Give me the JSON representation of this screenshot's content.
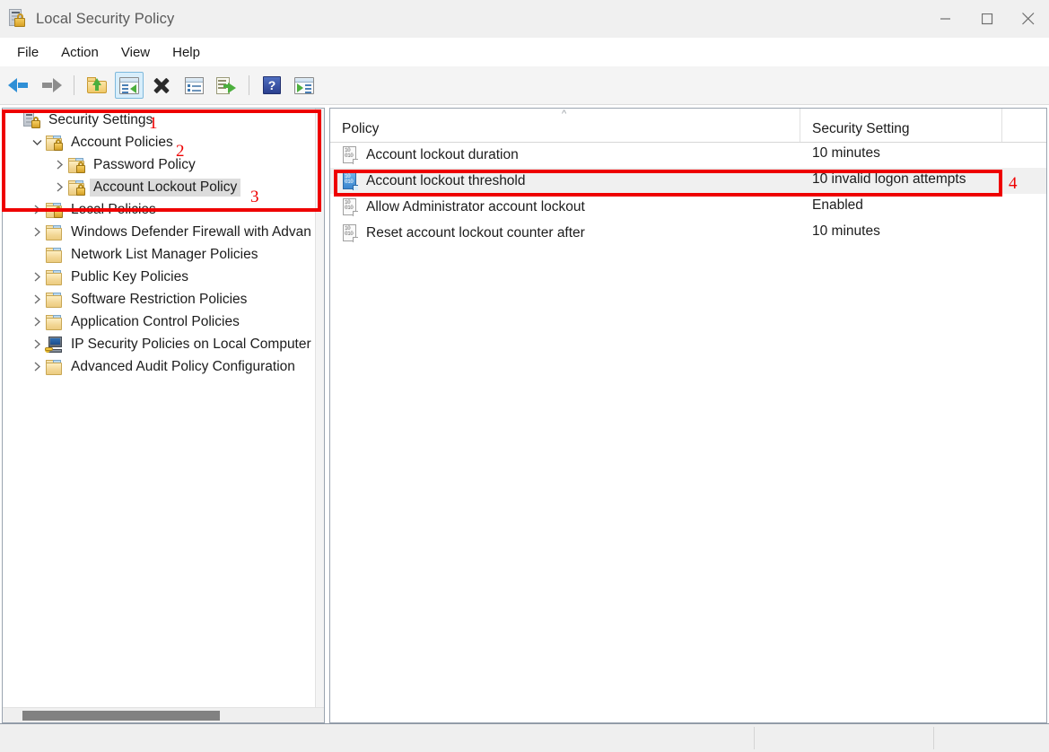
{
  "window": {
    "title": "Local Security Policy",
    "icon": "server-lock-icon",
    "controls": {
      "minimize": "minimize-button",
      "maximize": "maximize-button",
      "close": "close-button"
    }
  },
  "menubar": {
    "items": [
      {
        "label": "File"
      },
      {
        "label": "Action"
      },
      {
        "label": "View"
      },
      {
        "label": "Help"
      }
    ]
  },
  "toolbar": {
    "buttons": [
      {
        "name": "back-button",
        "icon": "back-arrow-icon"
      },
      {
        "name": "forward-button",
        "icon": "forward-arrow-icon"
      },
      {
        "name": "up-one-level-button",
        "icon": "folder-up-icon"
      },
      {
        "name": "show-hide-console-tree-button",
        "icon": "console-tree-icon",
        "selected": true
      },
      {
        "name": "delete-button",
        "icon": "delete-x-icon"
      },
      {
        "name": "properties-button",
        "icon": "properties-icon"
      },
      {
        "name": "export-list-button",
        "icon": "export-list-icon"
      },
      {
        "name": "help-button",
        "icon": "help-question-icon"
      },
      {
        "name": "show-action-pane-button",
        "icon": "action-pane-icon"
      }
    ]
  },
  "tree": {
    "items": [
      {
        "label": "Security Settings",
        "indent": 0,
        "chevron": "none",
        "icon": "server-lock-icon",
        "selected": false
      },
      {
        "label": "Account Policies",
        "indent": 1,
        "chevron": "expanded",
        "icon": "folder-lock-icon",
        "selected": false
      },
      {
        "label": "Password Policy",
        "indent": 2,
        "chevron": "collapsed",
        "icon": "folder-lock-icon",
        "selected": false
      },
      {
        "label": "Account Lockout Policy",
        "indent": 2,
        "chevron": "collapsed",
        "icon": "folder-lock-icon",
        "selected": true
      },
      {
        "label": "Local Policies",
        "indent": 1,
        "chevron": "collapsed",
        "icon": "folder-lock-icon",
        "selected": false
      },
      {
        "label": "Windows Defender Firewall with Advan",
        "indent": 1,
        "chevron": "collapsed",
        "icon": "folder-icon",
        "selected": false
      },
      {
        "label": "Network List Manager Policies",
        "indent": 1,
        "chevron": "none",
        "icon": "folder-icon",
        "selected": false
      },
      {
        "label": "Public Key Policies",
        "indent": 1,
        "chevron": "collapsed",
        "icon": "folder-icon",
        "selected": false
      },
      {
        "label": "Software Restriction Policies",
        "indent": 1,
        "chevron": "collapsed",
        "icon": "folder-icon",
        "selected": false
      },
      {
        "label": "Application Control Policies",
        "indent": 1,
        "chevron": "collapsed",
        "icon": "folder-icon",
        "selected": false
      },
      {
        "label": "IP Security Policies on Local Computer",
        "indent": 1,
        "chevron": "collapsed",
        "icon": "ip-security-icon",
        "selected": false
      },
      {
        "label": "Advanced Audit Policy Configuration",
        "indent": 1,
        "chevron": "collapsed",
        "icon": "folder-icon",
        "selected": false
      }
    ]
  },
  "list": {
    "columns": [
      {
        "label": "Policy",
        "sort": "ascending"
      },
      {
        "label": "Security Setting",
        "sort": "none"
      }
    ],
    "rows": [
      {
        "policy": "Account lockout duration",
        "setting": "10 minutes",
        "selected": false
      },
      {
        "policy": "Account lockout threshold",
        "setting": "10 invalid logon attempts",
        "selected": true
      },
      {
        "policy": "Allow Administrator account lockout",
        "setting": "Enabled",
        "selected": false
      },
      {
        "policy": "Reset account lockout counter after",
        "setting": "10 minutes",
        "selected": false
      }
    ]
  },
  "annotations": {
    "color": "#ee0000",
    "labels": [
      {
        "text": "1",
        "target": "security-settings-node"
      },
      {
        "text": "2",
        "target": "account-policies-node"
      },
      {
        "text": "3",
        "target": "account-lockout-policy-node"
      },
      {
        "text": "4",
        "target": "account-lockout-threshold-row"
      }
    ]
  },
  "statusbar": {
    "panes": [
      "",
      "",
      ""
    ]
  }
}
